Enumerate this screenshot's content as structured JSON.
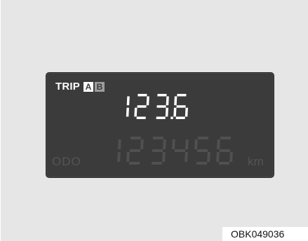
{
  "trip": {
    "label": "TRIP",
    "mode_a": "A",
    "mode_b": "B",
    "value": "123.6"
  },
  "odometer": {
    "label": "ODO",
    "value": "123456",
    "unit": "km"
  },
  "figure_code": "OBK049036",
  "colors": {
    "background": "#e6e6e6",
    "display": "#3b3b3b",
    "lit_segment": "#ffffff",
    "dim_segment": "#505050",
    "inactive_box": "#9c9c9c"
  }
}
